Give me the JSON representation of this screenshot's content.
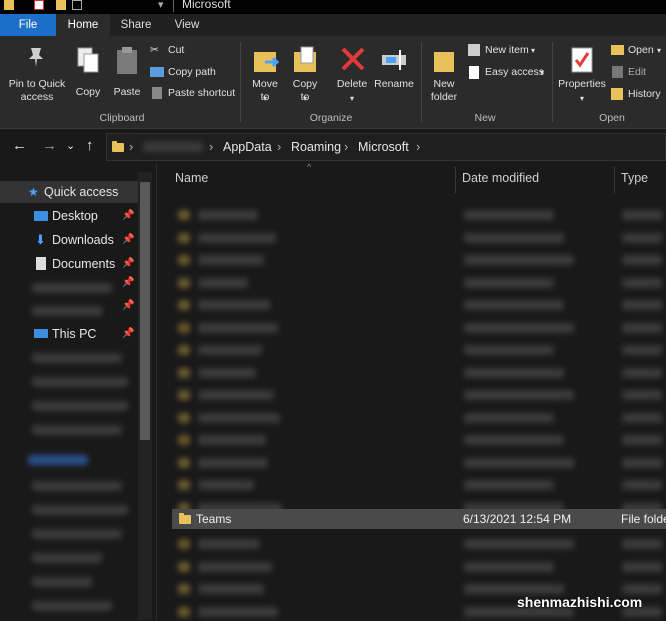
{
  "window": {
    "title": "Microsoft"
  },
  "ribbon_tabs": [
    "File",
    "Home",
    "Share",
    "View"
  ],
  "clipboard": {
    "pin_label": "Pin to Quick access",
    "copy_label": "Copy",
    "paste_label": "Paste",
    "cut_label": "Cut",
    "copy_path_label": "Copy path",
    "paste_shortcut_label": "Paste shortcut",
    "group_label": "Clipboard"
  },
  "organize": {
    "move_to_label": "Move to",
    "copy_to_label": "Copy to",
    "delete_label": "Delete",
    "rename_label": "Rename",
    "group_label": "Organize"
  },
  "new": {
    "new_folder_label": "New folder",
    "new_item_label": "New item",
    "easy_access_label": "Easy access",
    "group_label": "New"
  },
  "open": {
    "properties_label": "Properties",
    "open_label": "Open",
    "edit_label": "Edit",
    "history_label": "History",
    "group_label": "Open"
  },
  "address": {
    "crumbs": [
      "AppData",
      "Roaming",
      "Microsoft"
    ]
  },
  "nav_pane": {
    "quick_access": "Quick access",
    "desktop": "Desktop",
    "downloads": "Downloads",
    "documents": "Documents",
    "this_pc": "This PC"
  },
  "columns": {
    "name": "Name",
    "date_modified": "Date modified",
    "type": "Type"
  },
  "selected_row": {
    "name": "Teams",
    "date_modified": "6/13/2021 12:54 PM",
    "type": "File folde"
  },
  "watermark": "shenmazhishi.com",
  "colors": {
    "accent": "#1e6fc8",
    "folder": "#e8c15a",
    "delete": "#e23a3a"
  }
}
